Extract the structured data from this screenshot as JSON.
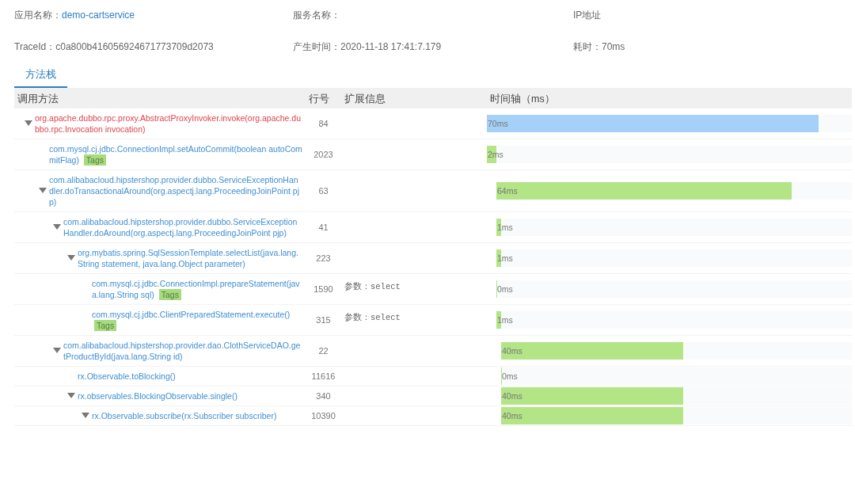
{
  "header": {
    "app_label": "应用名称：",
    "app_name": "demo-cartservice",
    "service_label": "服务名称：",
    "ip_label": "IP地址",
    "trace_label": "TraceId：",
    "trace_id": "c0a800b416056924671773709d2073",
    "time_label": "产生时间：",
    "time": "2020-11-18 17:41:7.179",
    "duration_label": "耗时：",
    "duration": "70ms"
  },
  "tabs": [
    {
      "label": "方法栈",
      "selected": true
    }
  ],
  "columns": [
    "调用方法",
    "行号",
    "扩展信息",
    "时间轴（ms）"
  ],
  "rows": [
    {
      "method": "org.apache.dubbo.rpc.proxy.AbstractProxyInvoker.invoke(org.apache.dubbo.rpc.Invocation invocation)",
      "error": true,
      "line": "84",
      "expanded": true,
      "duration": "70ms",
      "level": 0.909,
      "children": [
        {
          "method": "com.mysql.cj.jdbc.ConnectionImpl.setAutoCommit(boolean autoCommitFlag)",
          "tag": "Tags",
          "error": false,
          "line": "2023",
          "duration": "2ms",
          "level": 0.026
        },
        {
          "method": "com.alibabacloud.hipstershop.provider.dubbo.ServiceExceptionHandler.doTransactionalAround(org.aspectj.lang.ProceedingJoinPoint pjp)",
          "error": false,
          "line": "63",
          "expanded": true,
          "duration": "64ms",
          "level": 0.831,
          "children": [
            {
              "method": "com.alibabacloud.hipstershop.provider.dubbo.ServiceExceptionHandler.doAround(org.aspectj.lang.ProceedingJoinPoint pjp)",
              "error": false,
              "line": "41",
              "expanded": true,
              "duration": "1ms",
              "level": 0.013,
              "children": [
                {
                  "method": "org.mybatis.spring.SqlSessionTemplate.selectList(java.lang.String statement, java.lang.Object parameter)",
                  "error": false,
                  "line": "223",
                  "expanded": true,
                  "duration": "1ms",
                  "level": 0.013,
                  "children": [
                    {
                      "method": "com.mysql.cj.jdbc.ConnectionImpl.prepareStatement(java.lang.String sql)",
                      "tag": "Tags",
                      "error": false,
                      "line": "1590",
                      "ext": "参数：select",
                      "duration": "0ms",
                      "level": 0
                    },
                    {
                      "method": "com.mysql.cj.jdbc.ClientPreparedStatement.execute()",
                      "tag": "Tags",
                      "error": false,
                      "line": "315",
                      "ext": "参数：select",
                      "duration": "1ms",
                      "level": 0.013
                    }
                  ]
                }
              ]
            },
            {
              "method": "com.alibabacloud.hipstershop.provider.dao.ClothServiceDAO.getProductById(java.lang.String id)",
              "error": false,
              "line": "22",
              "expanded": true,
              "duration": "40ms",
              "level": 0.519,
              "children": [
                {
                  "method": "rx.Observable.toBlocking()",
                  "error": false,
                  "line": "11616",
                  "duration": "0ms",
                  "level": 0
                },
                {
                  "method": "rx.observables.BlockingObservable.single()",
                  "error": false,
                  "line": "340",
                  "expanded": true,
                  "duration": "40ms",
                  "level": 0.519,
                  "children": [
                    {
                      "method": "rx.Observable.subscribe(rx.Subscriber subscriber)",
                      "error": false,
                      "line": "10390",
                      "expanded": true,
                      "duration": "40ms",
                      "level": 0.519
                    }
                  ]
                }
              ]
            }
          ]
        }
      ]
    }
  ]
}
